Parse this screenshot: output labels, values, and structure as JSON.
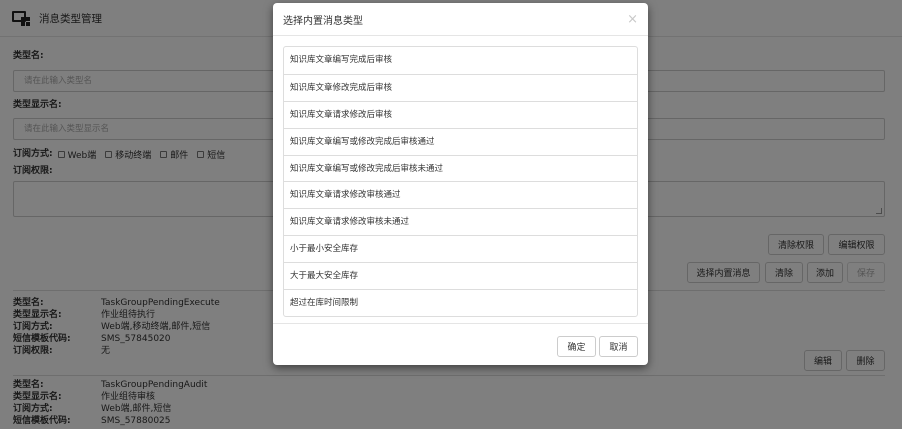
{
  "header": {
    "title": "消息类型管理",
    "icon": "message-settings-icon"
  },
  "form": {
    "type_name_label": "类型名:",
    "type_name_placeholder": "请在此输入类型名",
    "display_name_label": "类型显示名:",
    "display_name_placeholder": "请在此输入类型显示名",
    "subscribe_label": "订阅方式:",
    "subscribe_options": [
      "Web端",
      "移动终端",
      "邮件",
      "短信"
    ],
    "permission_label": "订阅权限:"
  },
  "buttons": {
    "clear_permission": "清除权限",
    "edit_permission": "编辑权限",
    "select_builtin": "选择内置消息",
    "clear": "清除",
    "add": "添加",
    "save": "保存",
    "edit": "编辑",
    "delete": "删除"
  },
  "records": [
    {
      "lines": [
        {
          "k": "类型名:",
          "v": "TaskGroupPendingExecute"
        },
        {
          "k": "类型显示名:",
          "v": "作业组待执行"
        },
        {
          "k": "订阅方式:",
          "v": "Web端,移动终端,邮件,短信"
        },
        {
          "k": "短信模板代码:",
          "v": "SMS_57845020"
        },
        {
          "k": "订阅权限:",
          "v": "无"
        }
      ]
    },
    {
      "lines": [
        {
          "k": "类型名:",
          "v": "TaskGroupPendingAudit"
        },
        {
          "k": "类型显示名:",
          "v": "作业组待审核"
        },
        {
          "k": "订阅方式:",
          "v": "Web端,邮件,短信"
        },
        {
          "k": "短信模板代码:",
          "v": "SMS_57880025"
        }
      ]
    }
  ],
  "modal": {
    "title": "选择内置消息类型",
    "close": "×",
    "items": [
      "知识库文章编写完成后审核",
      "知识库文章修改完成后审核",
      "知识库文章请求修改后审核",
      "知识库文章编写或修改完成后审核通过",
      "知识库文章编写或修改完成后审核未通过",
      "知识库文章请求修改审核通过",
      "知识库文章请求修改审核未通过",
      "小于最小安全库存",
      "大于最大安全库存",
      "超过在库时间限制"
    ],
    "ok": "确定",
    "cancel": "取消"
  }
}
